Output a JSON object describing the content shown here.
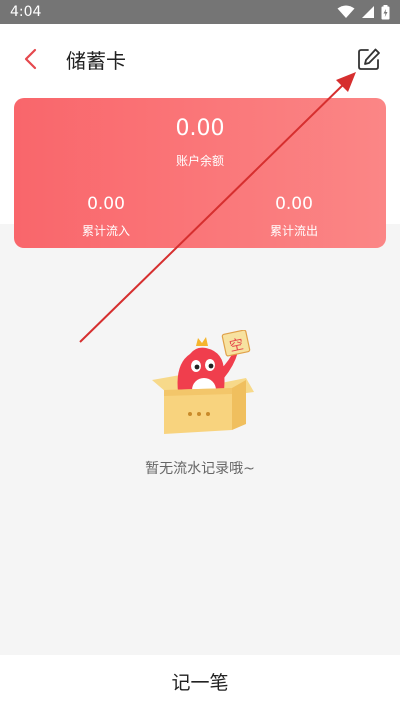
{
  "status_bar": {
    "time": "4:04"
  },
  "header": {
    "title": "储蓄卡"
  },
  "card": {
    "balance": "0.00",
    "balance_label": "账户余额",
    "inflow": "0.00",
    "inflow_label": "累计流入",
    "outflow": "0.00",
    "outflow_label": "累计流出"
  },
  "empty_state": {
    "sign_char": "空",
    "text": "暂无流水记录哦~"
  },
  "bottom": {
    "record_label": "记一笔"
  },
  "colors": {
    "accent": "#e5484d",
    "card_start": "#f9666b",
    "card_end": "#fb8686",
    "annotation": "#d62f2f"
  },
  "icons": [
    "back-arrow-icon",
    "edit-icon",
    "wifi-icon",
    "signal-icon",
    "battery-icon"
  ]
}
